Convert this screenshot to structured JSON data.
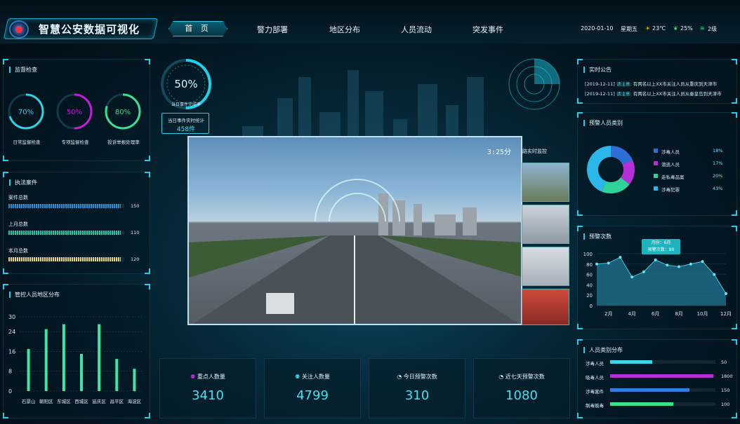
{
  "header": {
    "title": "智慧公安数据可视化",
    "nav": [
      "首 页",
      "警力部署",
      "地区分布",
      "人员流动",
      "突发事件"
    ],
    "date": "2020-01-10",
    "weekday": "星期五",
    "temperature": "23℃",
    "humidity": "25%",
    "wind": "2级",
    "colors": {
      "accent": "#1fd0e8",
      "brand": "#0b5e72"
    }
  },
  "supervision": {
    "title": "监督检查",
    "rings": [
      {
        "value": "70%",
        "label": "日常监督检查",
        "pct": 0.7,
        "color": "#2fd3e8"
      },
      {
        "value": "50%",
        "label": "专项监督检查",
        "pct": 0.5,
        "color": "#c21fd6"
      },
      {
        "value": "80%",
        "label": "投诉举报处理率",
        "pct": 0.8,
        "color": "#39e28f"
      }
    ]
  },
  "cases": {
    "title": "执法案件",
    "rows": [
      {
        "label": "案件总数",
        "value": "150",
        "pct": 0.97,
        "color": "#2d8fd8"
      },
      {
        "label": "上月总数",
        "value": "110",
        "pct": 0.97,
        "color": "#26c9a7"
      },
      {
        "label": "本月总数",
        "value": "120",
        "pct": 0.97,
        "color": "#e8d27a"
      }
    ]
  },
  "district": {
    "title": "管控人员地区分布",
    "chart_data": {
      "type": "bar",
      "categories": [
        "石景山",
        "朝阳区",
        "东城区",
        "西城区",
        "延庆区",
        "昌平区",
        "海淀区"
      ],
      "values": [
        17,
        25,
        27,
        15,
        27,
        13,
        9
      ],
      "ylim": [
        0,
        30
      ],
      "yticks": [
        "0",
        "8",
        "16",
        "24",
        "30"
      ]
    }
  },
  "center": {
    "gauge_value": "50%",
    "gauge_label": "当日事件完成率",
    "event_label": "当日事件实时统计",
    "event_count": "458件",
    "video_timer": "3:25分",
    "monitor_title": "路实时监控"
  },
  "stats": [
    {
      "label": "重点人数量",
      "value": "3410",
      "icon": "people-icon"
    },
    {
      "label": "关注人数量",
      "value": "4799",
      "icon": "people-icon"
    },
    {
      "label": "今日预警次数",
      "value": "310",
      "icon": "alert-icon"
    },
    {
      "label": "近七天预警次数",
      "value": "1080",
      "icon": "alert-icon"
    }
  ],
  "notices": {
    "title": "实时公告",
    "items": [
      {
        "date": "[2019-12-11]",
        "tag": "请注意:",
        "text": "有两名以上XX市关注人员从重庆到天津市"
      },
      {
        "date": "[2019-12-11]",
        "tag": "请注意:",
        "text": "有两名以上XX市关注人员从秦皇岛到天津市"
      }
    ]
  },
  "categories": {
    "title": "预警人员类别",
    "chart_data": {
      "type": "pie",
      "labels": [
        "涉毒人员",
        "潜逃人员",
        "走私毒品案",
        "涉毒犯罪"
      ],
      "values": [
        18,
        17,
        20,
        43
      ],
      "colors": [
        "#2d6fd8",
        "#b42fd6",
        "#2fd39a",
        "#2bb7e8"
      ]
    },
    "pcts": [
      "18%",
      "17%",
      "20%",
      "43%"
    ]
  },
  "warnings": {
    "title": "预警次数",
    "tooltip_month": "月份：6月",
    "tooltip_count": "预警次数：88",
    "chart_data": {
      "type": "area",
      "x": [
        "1月",
        "2月",
        "3月",
        "4月",
        "5月",
        "6月",
        "7月",
        "8月",
        "9月",
        "10月",
        "11月",
        "12月"
      ],
      "values": [
        80,
        82,
        93,
        55,
        65,
        88,
        78,
        75,
        80,
        85,
        60,
        23
      ],
      "xticks": [
        "2月",
        "4月",
        "6月",
        "8月",
        "10月",
        "12月"
      ],
      "ylim": [
        0,
        100
      ],
      "yticks": [
        "0",
        "20",
        "40",
        "60",
        "80",
        "100"
      ]
    }
  },
  "person_types": {
    "title": "人员类别分布",
    "rows": [
      {
        "label": "涉毒人员",
        "value": "50",
        "pct": 0.4,
        "color": "#3bd6e8"
      },
      {
        "label": "吸毒人员",
        "value": "1800",
        "pct": 0.98,
        "color": "#b42fd6"
      },
      {
        "label": "涉毒案件",
        "value": "150",
        "pct": 0.75,
        "color": "#2f7fe0"
      },
      {
        "label": "制毒贩毒",
        "value": "100",
        "pct": 0.6,
        "color": "#39e28f"
      }
    ]
  }
}
